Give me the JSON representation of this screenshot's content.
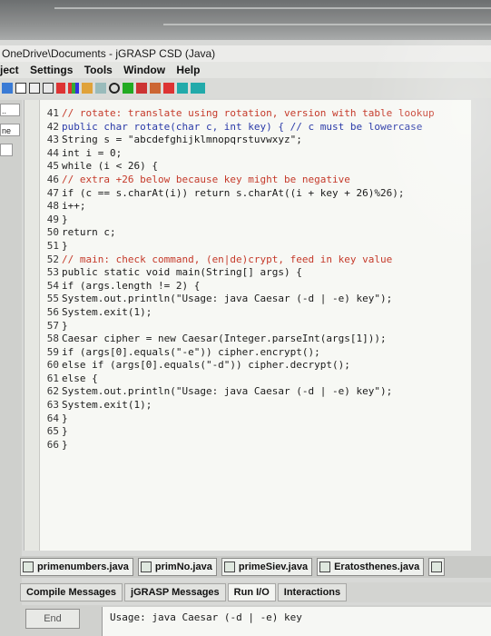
{
  "window": {
    "title": "OneDrive\\Documents - jGRASP CSD (Java)"
  },
  "menu": [
    "ject",
    "Settings",
    "Tools",
    "Window",
    "Help"
  ],
  "left_strip": {
    "box1": "..",
    "box2": "ne"
  },
  "code_lines": [
    {
      "n": "41",
      "t": "// rotate: translate using rotation, version with table lookup",
      "c": "cm"
    },
    {
      "n": "42",
      "t": "public char rotate(char c, int key) { // c must be lowercase",
      "c": "kw"
    },
    {
      "n": "43",
      "t": "String s = \"abcdefghijklmnopqrstuvwxyz\";",
      "c": ""
    },
    {
      "n": "44",
      "t": "int i = 0;",
      "c": ""
    },
    {
      "n": "45",
      "t": "while (i < 26) {",
      "c": ""
    },
    {
      "n": "46",
      "t": "// extra +26 below because key might be negative",
      "c": "cm"
    },
    {
      "n": "47",
      "t": "if (c == s.charAt(i)) return s.charAt((i + key + 26)%26);",
      "c": ""
    },
    {
      "n": "48",
      "t": "i++;",
      "c": ""
    },
    {
      "n": "49",
      "t": "}",
      "c": ""
    },
    {
      "n": "50",
      "t": "return c;",
      "c": ""
    },
    {
      "n": "51",
      "t": "}",
      "c": ""
    },
    {
      "n": "52",
      "t": "// main: check command, (en|de)crypt, feed in key value",
      "c": "cm"
    },
    {
      "n": "53",
      "t": "public static void main(String[] args) {",
      "c": ""
    },
    {
      "n": "54",
      "t": "if (args.length != 2) {",
      "c": ""
    },
    {
      "n": "55",
      "t": "System.out.println(\"Usage: java Caesar (-d | -e) key\");",
      "c": ""
    },
    {
      "n": "56",
      "t": "System.exit(1);",
      "c": ""
    },
    {
      "n": "57",
      "t": "}",
      "c": ""
    },
    {
      "n": "58",
      "t": "Caesar cipher = new Caesar(Integer.parseInt(args[1]));",
      "c": ""
    },
    {
      "n": "59",
      "t": "if (args[0].equals(\"-e\")) cipher.encrypt();",
      "c": ""
    },
    {
      "n": "60",
      "t": "else if (args[0].equals(\"-d\")) cipher.decrypt();",
      "c": ""
    },
    {
      "n": "61",
      "t": "else {",
      "c": ""
    },
    {
      "n": "62",
      "t": "System.out.println(\"Usage: java Caesar (-d | -e) key\");",
      "c": ""
    },
    {
      "n": "63",
      "t": "System.exit(1);",
      "c": ""
    },
    {
      "n": "64",
      "t": "}",
      "c": ""
    },
    {
      "n": "65",
      "t": "}",
      "c": ""
    },
    {
      "n": "66",
      "t": "}",
      "c": ""
    }
  ],
  "file_tabs": [
    "primenumbers.java",
    "primNo.java",
    "primeSiev.java",
    "Eratosthenes.java"
  ],
  "message_tabs": [
    "Compile Messages",
    "jGRASP Messages",
    "Run I/O",
    "Interactions"
  ],
  "run": {
    "end_label": "End",
    "output": "Usage: java Caesar (-d | -e) key"
  }
}
